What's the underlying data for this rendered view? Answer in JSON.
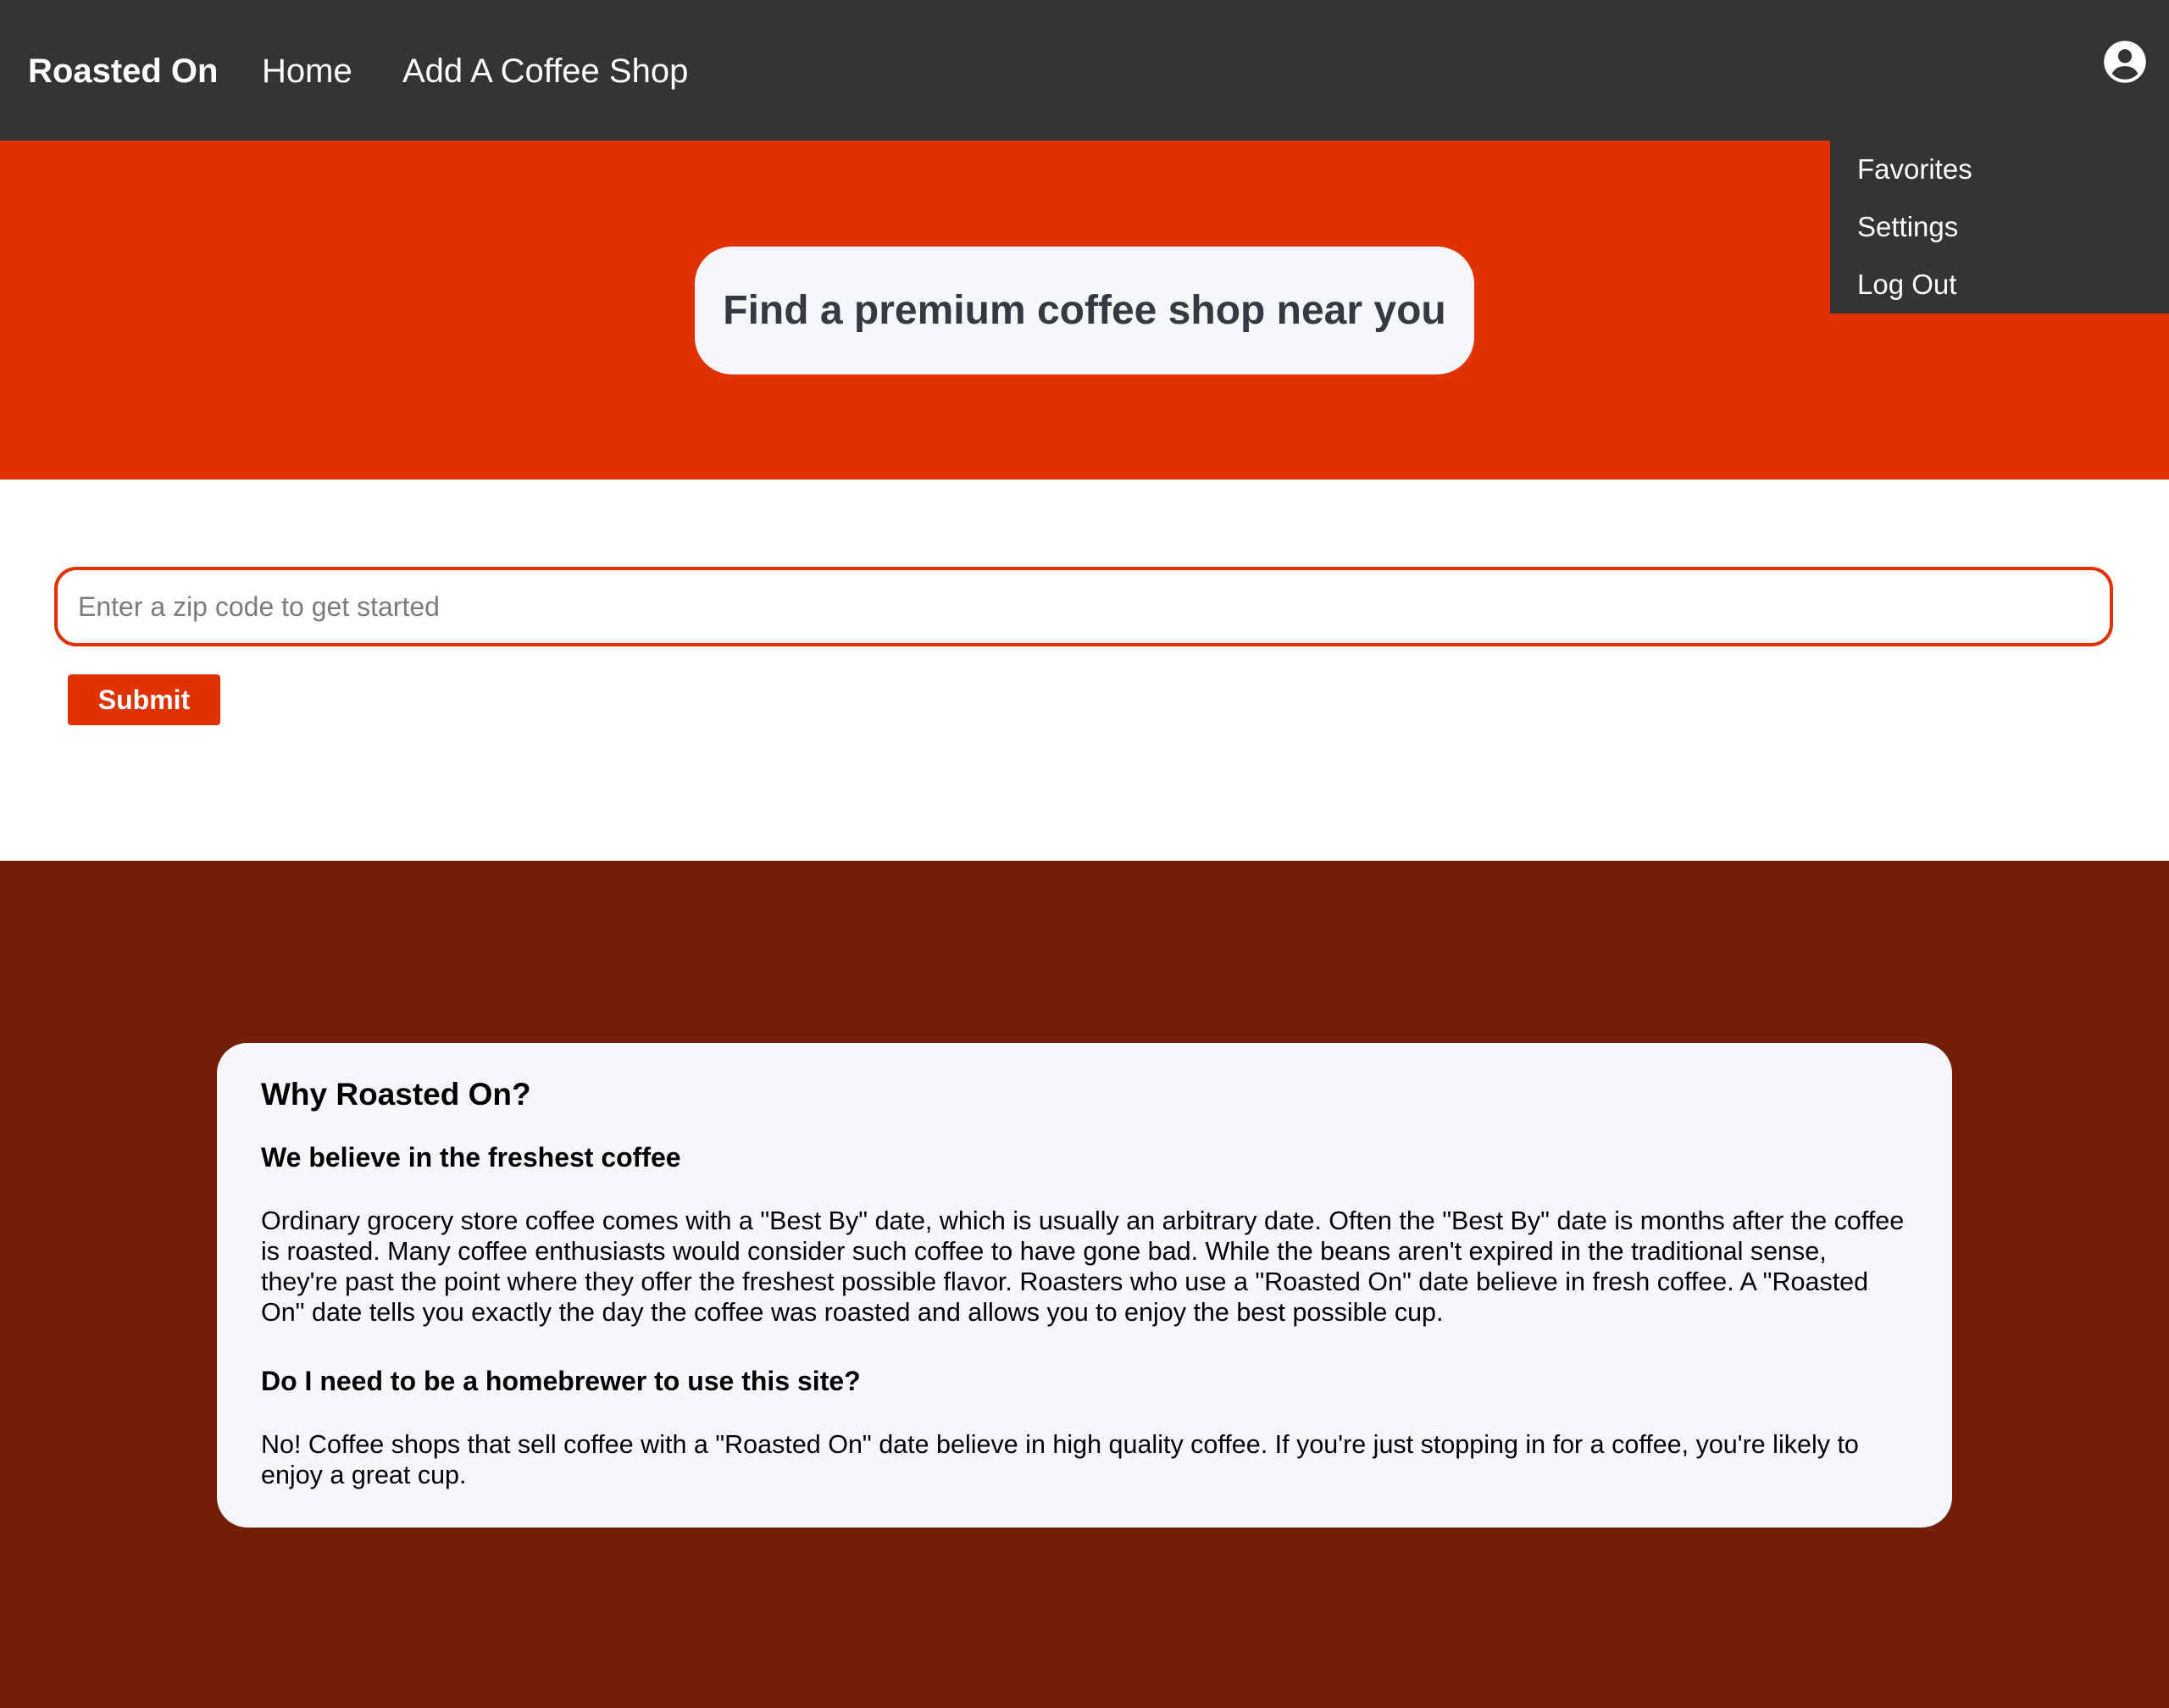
{
  "nav": {
    "brand": "Roasted On",
    "home": "Home",
    "add_shop": "Add A Coffee Shop",
    "account_icon": "account-circle-icon"
  },
  "dropdown": {
    "favorites": "Favorites",
    "settings": "Settings",
    "logout": "Log Out"
  },
  "hero": {
    "title": "Find a premium coffee shop near you"
  },
  "search": {
    "placeholder": "Enter a zip code to get started",
    "value": "",
    "submit_label": "Submit"
  },
  "about": {
    "title": "Why Roasted On?",
    "q1": "We believe in the freshest coffee",
    "a1": "Ordinary grocery store coffee comes with a \"Best By\" date, which is usually an arbitrary date. Often the \"Best By\" date is months after the coffee is roasted. Many coffee enthusiasts would consider such coffee to have gone bad. While the beans aren't expired in the traditional sense, they're past the point where they offer the freshest possible flavor. Roasters who use a \"Roasted On\" date believe in fresh coffee. A \"Roasted On\" date tells you exactly the day the coffee was roasted and allows you to enjoy the best possible cup.",
    "q2": "Do I need to be a homebrewer to use this site?",
    "a2": "No! Coffee shops that sell coffee with a \"Roasted On\" date believe in high quality coffee. If you're just stopping in for a coffee, you're likely to enjoy a great cup."
  },
  "colors": {
    "nav_bg": "#343434",
    "hero_bg": "#e03100",
    "accent": "#e03100",
    "about_bg": "#731e07",
    "card_bg": "#f5f7fa"
  }
}
